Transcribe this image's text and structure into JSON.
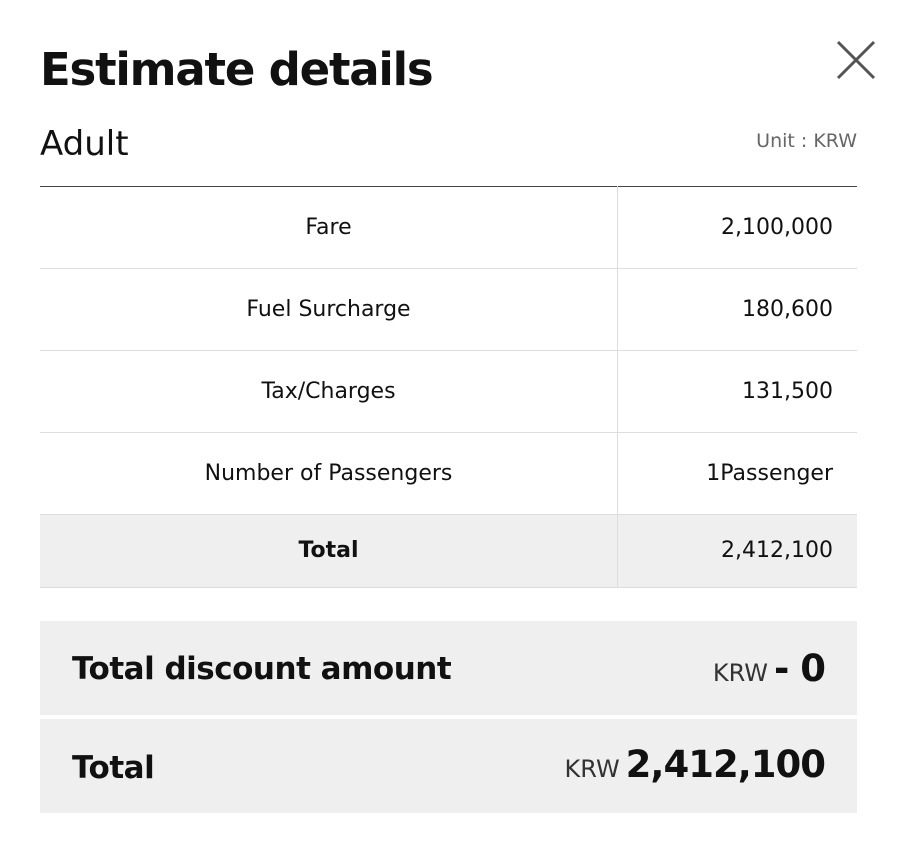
{
  "modal": {
    "title": "Estimate details",
    "close_icon": "close-icon"
  },
  "section": {
    "title": "Adult",
    "unit": "Unit : KRW"
  },
  "table": {
    "rows": [
      {
        "label": "Fare",
        "value": "2,100,000"
      },
      {
        "label": "Fuel Surcharge",
        "value": "180,600"
      },
      {
        "label": "Tax/Charges",
        "value": "131,500"
      },
      {
        "label": "Number of Passengers",
        "value": "1Passenger"
      }
    ],
    "total": {
      "label": "Total",
      "value": "2,412,100"
    }
  },
  "discount": {
    "label": "Total discount amount",
    "currency": "KRW",
    "amount": "- 0"
  },
  "grand_total": {
    "label": "Total",
    "currency": "KRW",
    "amount": "2,412,100"
  }
}
